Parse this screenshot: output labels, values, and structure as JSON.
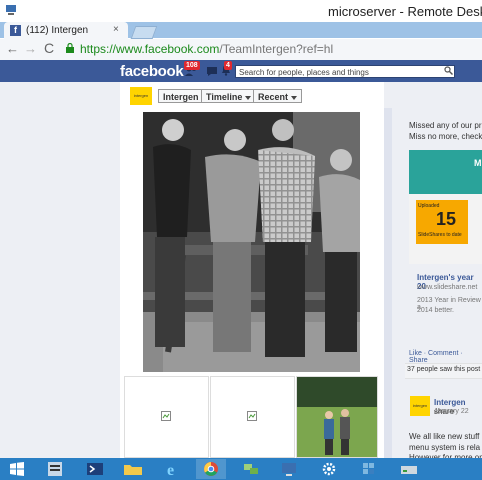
{
  "rdp": {
    "title": "microserver - Remote Desktop"
  },
  "browser": {
    "tab_title": "(112) Intergen",
    "tab_close": "×",
    "url_host": "https://www.facebook.com",
    "url_path": "/TeamIntergen?ref=hl",
    "back": "←",
    "forward": "→",
    "reload": "C"
  },
  "fb_bar": {
    "logo": "facebook",
    "friends_badge": "108",
    "bell_badge": "4",
    "search_placeholder": "Search for people, places and things"
  },
  "page_nav": {
    "logo_text": "intergen",
    "items": [
      "Intergen",
      "Timeline",
      "Recent"
    ]
  },
  "right_col": {
    "post1_line1": "Missed any of our pr",
    "post1_line2": "Miss no more, check",
    "slideshare": {
      "banner_letter": "M",
      "uploaded": "Uploaded",
      "number": "15",
      "sub": "SlideShares to date",
      "title": "Intergen's year 20",
      "domain": "www.slideshare.net",
      "desc1": "2013 Year in Review a",
      "desc2": "2014 better."
    },
    "post1_actions": "Like · Comment · Share",
    "seen": "37 people saw this post",
    "post2": {
      "avatar_text": "intergen",
      "author": "Intergen",
      "author_suffix": " share",
      "date": "January 22",
      "line1": "We all like new stuff",
      "line2": "menu system is rela",
      "line3": "However for more on"
    }
  },
  "colors": {
    "fb_blue": "#3b5998",
    "taskbar": "#2a7fc4",
    "url_green": "#1c8a1c",
    "badge_red": "#e0282f"
  },
  "taskbar": {
    "icons": [
      "start-icon",
      "server-manager-icon",
      "powershell-icon",
      "explorer-icon",
      "internet-explorer-icon",
      "chrome-icon",
      "network-icon",
      "remote-desktop-icon",
      "settings-icon",
      "registry-icon",
      "drive-icon"
    ]
  }
}
